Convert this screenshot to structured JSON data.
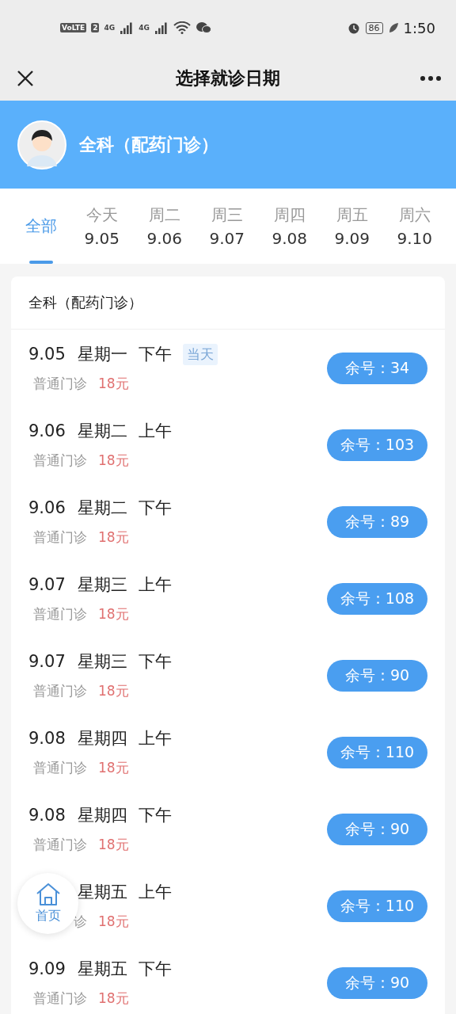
{
  "status_bar": {
    "volte": "VoLTE",
    "sim": "2",
    "signals": [
      "4G",
      "4G"
    ],
    "battery": "86",
    "time": "1:50"
  },
  "nav": {
    "title": "选择就诊日期"
  },
  "department": {
    "name": "全科（配药门诊）"
  },
  "date_tabs": [
    {
      "label": "全部",
      "selected": true
    },
    {
      "label": "今天",
      "date": "9.05",
      "selected": false
    },
    {
      "label": "周二",
      "date": "9.06",
      "selected": false
    },
    {
      "label": "周三",
      "date": "9.07",
      "selected": false
    },
    {
      "label": "周四",
      "date": "9.08",
      "selected": false
    },
    {
      "label": "周五",
      "date": "9.09",
      "selected": false
    },
    {
      "label": "周六",
      "date": "9.10",
      "selected": false
    }
  ],
  "card": {
    "title": "全科（配药门诊）",
    "slots": [
      {
        "date": "9.05",
        "weekday": "星期一",
        "period": "下午",
        "tag": "当天",
        "clinic": "普通门诊",
        "fee": "18元",
        "remaining": "余号：34"
      },
      {
        "date": "9.06",
        "weekday": "星期二",
        "period": "上午",
        "clinic": "普通门诊",
        "fee": "18元",
        "remaining": "余号：103"
      },
      {
        "date": "9.06",
        "weekday": "星期二",
        "period": "下午",
        "clinic": "普通门诊",
        "fee": "18元",
        "remaining": "余号：89"
      },
      {
        "date": "9.07",
        "weekday": "星期三",
        "period": "上午",
        "clinic": "普通门诊",
        "fee": "18元",
        "remaining": "余号：108"
      },
      {
        "date": "9.07",
        "weekday": "星期三",
        "period": "下午",
        "clinic": "普通门诊",
        "fee": "18元",
        "remaining": "余号：90"
      },
      {
        "date": "9.08",
        "weekday": "星期四",
        "period": "上午",
        "clinic": "普通门诊",
        "fee": "18元",
        "remaining": "余号：110"
      },
      {
        "date": "9.08",
        "weekday": "星期四",
        "period": "下午",
        "clinic": "普通门诊",
        "fee": "18元",
        "remaining": "余号：90"
      },
      {
        "weekday": "星期五",
        "period": "上午",
        "clinic": "诊",
        "fee": "18元",
        "remaining": "余号：110"
      },
      {
        "date": "9.09",
        "weekday": "星期五",
        "period": "下午",
        "clinic": "普通门诊",
        "fee": "18元",
        "remaining": "余号：90"
      }
    ]
  },
  "home_button": {
    "label": "首页"
  }
}
